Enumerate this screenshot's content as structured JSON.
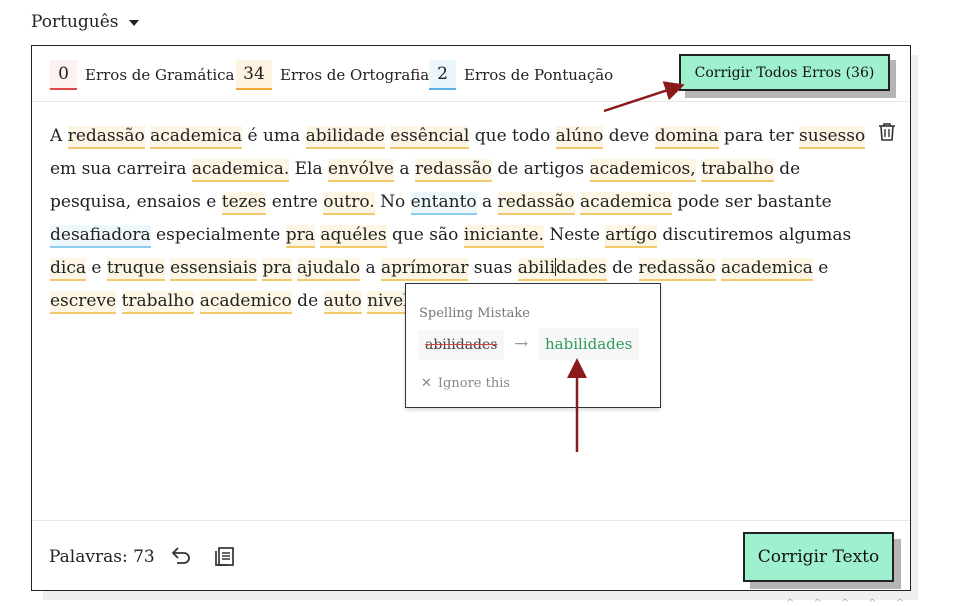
{
  "language": {
    "selected": "Português"
  },
  "counters": [
    {
      "count": "0",
      "label": "Erros de Gramática",
      "color": "#e04848"
    },
    {
      "count": "34",
      "label": "Erros de Ortografia",
      "color": "#f0a830"
    },
    {
      "count": "2",
      "label": "Erros de Pontuação",
      "color": "#59b1e6"
    }
  ],
  "toolbar": {
    "fix_all_label": "Corrigir Todos Erros (36)"
  },
  "text_segments": [
    [
      "A ",
      null
    ],
    [
      "redassão",
      "o"
    ],
    [
      " ",
      null
    ],
    [
      "academica",
      "o"
    ],
    [
      " é uma ",
      null
    ],
    [
      "abilidade",
      "o"
    ],
    [
      " ",
      null
    ],
    [
      "essêncial",
      "o"
    ],
    [
      " que todo ",
      null
    ],
    [
      "alúno",
      "o"
    ],
    [
      " deve ",
      null
    ],
    [
      "domina",
      "o"
    ],
    [
      " para ter ",
      null
    ],
    [
      "susesso",
      "o"
    ],
    [
      " em sua carreira ",
      null
    ],
    [
      "academica.",
      "o"
    ],
    [
      " Ela ",
      null
    ],
    [
      "envólve",
      "o"
    ],
    [
      " a ",
      null
    ],
    [
      "redassão",
      "o"
    ],
    [
      " de artigos ",
      null
    ],
    [
      "academicos,",
      "o"
    ],
    [
      " ",
      null
    ],
    [
      "trabalho",
      "o"
    ],
    [
      " de pesquisa, ensaios e ",
      null
    ],
    [
      "tezes",
      "o"
    ],
    [
      " entre ",
      null
    ],
    [
      "outro.",
      "o"
    ],
    [
      " No ",
      null
    ],
    [
      "entanto",
      "b"
    ],
    [
      " a ",
      null
    ],
    [
      "redassão",
      "o"
    ],
    [
      " ",
      null
    ],
    [
      "academica",
      "o"
    ],
    [
      " pode ser bastante ",
      null
    ],
    [
      "desafiadora",
      "b"
    ],
    [
      " especialmente ",
      null
    ],
    [
      "pra",
      "o"
    ],
    [
      " ",
      null
    ],
    [
      "aquéles",
      "o"
    ],
    [
      " que são ",
      null
    ],
    [
      "iniciante.",
      "o"
    ],
    [
      " Neste ",
      null
    ],
    [
      "artígo",
      "o"
    ],
    [
      " discutiremos algumas ",
      null
    ],
    [
      "dica",
      "o"
    ],
    [
      " e ",
      null
    ],
    [
      "truque",
      "o"
    ],
    [
      " ",
      null
    ],
    [
      "essensiais",
      "o"
    ],
    [
      " ",
      null
    ],
    [
      "pra",
      "o"
    ],
    [
      " ",
      null
    ],
    [
      "ajudalo",
      "o"
    ],
    [
      " a ",
      null
    ],
    [
      "aprímorar",
      "o"
    ],
    [
      " suas ",
      null
    ],
    [
      "abilidades",
      "o"
    ],
    [
      " de ",
      null
    ],
    [
      "redassão",
      "o"
    ],
    [
      " ",
      null
    ],
    [
      "academica",
      "o"
    ],
    [
      " e ",
      null
    ],
    [
      "escreve",
      "o"
    ],
    [
      " ",
      null
    ],
    [
      "trabalho",
      "o"
    ],
    [
      " ",
      null
    ],
    [
      "academico",
      "o"
    ],
    [
      " de ",
      null
    ],
    [
      "auto",
      "o"
    ],
    [
      " ",
      null
    ],
    [
      "nivel",
      "o"
    ],
    [
      ".",
      null
    ]
  ],
  "popup": {
    "title": "Spelling Mistake",
    "original": "abilidades",
    "suggestion": "habilidades",
    "ignore_label": "Ignore this"
  },
  "footer": {
    "word_count": "Palavras: 73",
    "fix_text_label": "Corrigir Texto"
  },
  "icons": {
    "delete": "trash-icon",
    "undo": "undo-icon",
    "copy": "copy-icon",
    "language": "chevron-down-icon"
  },
  "colors": {
    "accent": "#9ff0cf",
    "annotation_arrow": "#8b1a1a",
    "suggestion": "#2e9a5e"
  }
}
